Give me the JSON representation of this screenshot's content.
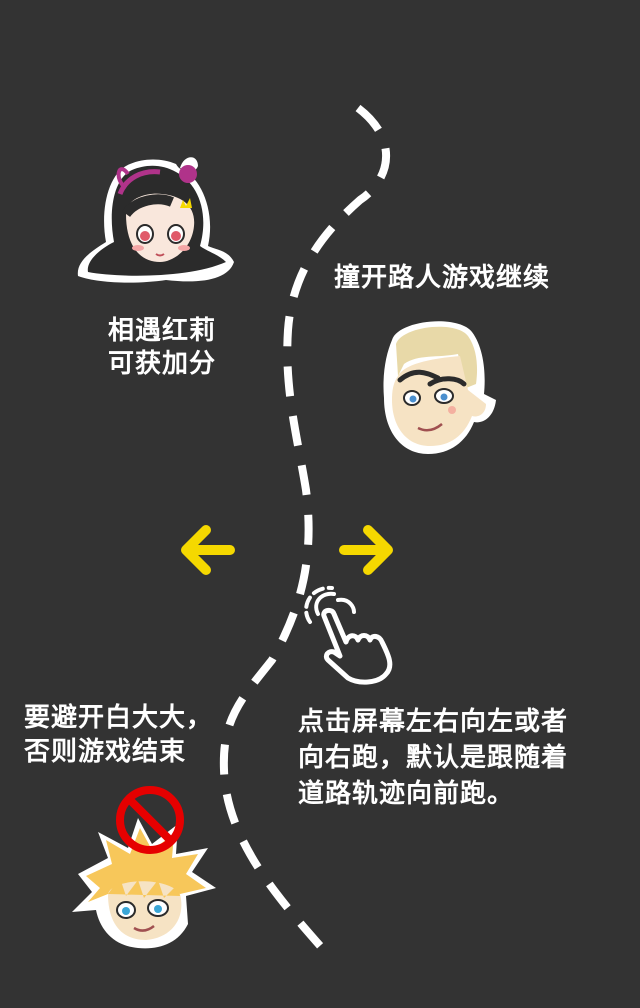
{
  "colors": {
    "background": "#333333",
    "text": "#ffffff",
    "arrow": "#f5d800",
    "path": "#ffffff",
    "forbidden": "#e60000",
    "hongli_hair": "#7a1f5c"
  },
  "tips": {
    "hongli": {
      "line1": "相遇红莉",
      "line2": "可获加分",
      "icon": "girl-face-icon"
    },
    "pedestrian": {
      "text": "撞开路人游戏继续",
      "icon": "blond-man-face-icon"
    },
    "avoid": {
      "line1": "要避开白大大，",
      "line2": "否则游戏结束",
      "icon": "spiky-hair-boy-face-icon",
      "badge": "no-entry-icon"
    },
    "control": {
      "line1": "点击屏幕左右向左或者",
      "line2": "向右跑，默认是跟随着",
      "line3": "道路轨迹向前跑。",
      "icon": "tap-hand-icon"
    }
  },
  "arrows": {
    "left": "arrow-left-icon",
    "right": "arrow-right-icon"
  }
}
